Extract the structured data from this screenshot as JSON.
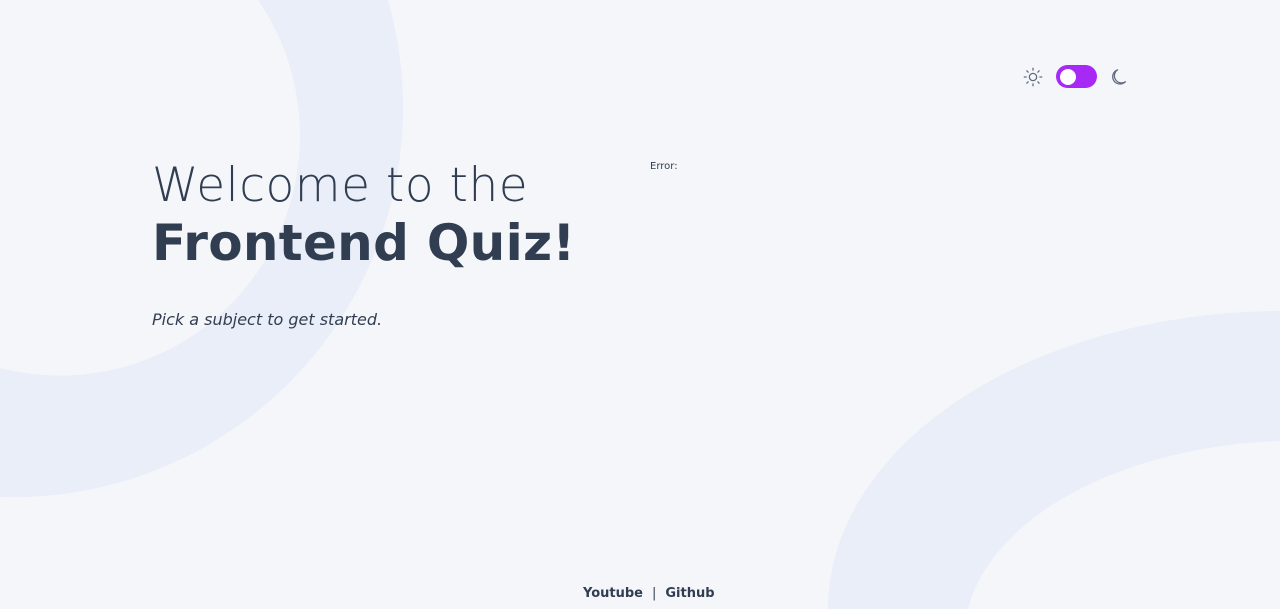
{
  "theme": {
    "mode": "light",
    "accent_color": "#a729f5",
    "background_color": "#f4f6fa",
    "pattern_color": "#e8edf8",
    "text_color": "#313e51",
    "sun_icon": "sun-icon",
    "moon_icon": "moon-icon"
  },
  "hero": {
    "title_light": "Welcome to the",
    "title_bold": "Frontend Quiz!",
    "subtitle": "Pick a subject to get started."
  },
  "error": {
    "label": "Error:"
  },
  "footer": {
    "youtube_label": "Youtube",
    "separator": "|",
    "github_label": "Github"
  }
}
